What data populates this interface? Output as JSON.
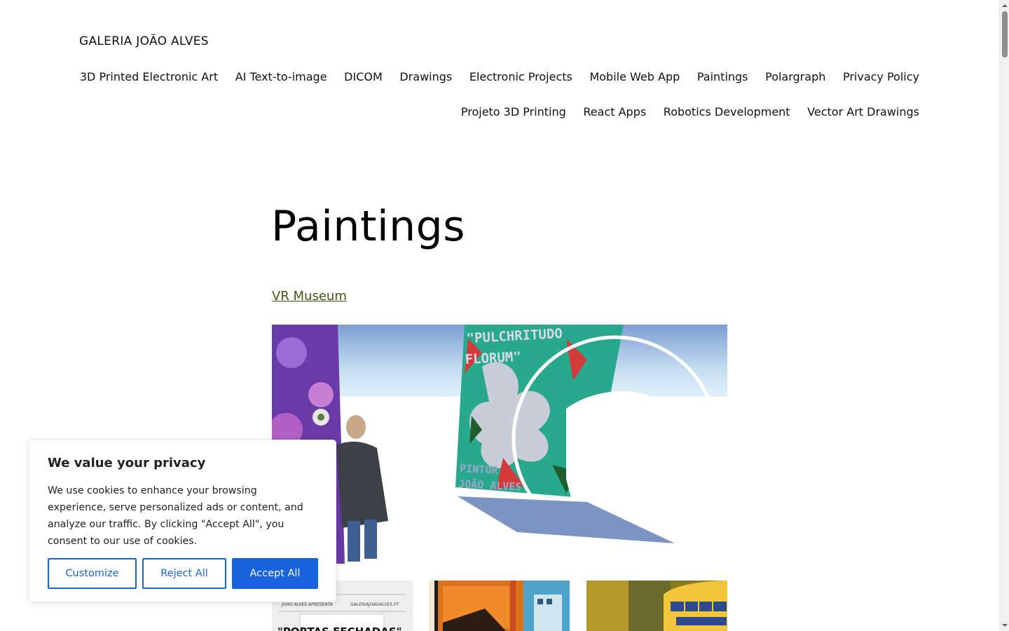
{
  "site": {
    "title": "GALERIA JOÃO ALVES"
  },
  "nav": {
    "row1": [
      "3D Printed Electronic Art",
      "AI Text-to-image",
      "DICOM",
      "Drawings",
      "Electronic Projects",
      "Mobile Web App",
      "Paintings",
      "Polargraph",
      "Privacy Policy"
    ],
    "row2": [
      "Projeto 3D Printing",
      "React Apps",
      "Robotics Development",
      "Vector Art Drawings"
    ]
  },
  "main": {
    "title": "Paintings",
    "link": "VR Museum",
    "hero": {
      "poster_line1": "\"PULCHRITUDO",
      "poster_line2": "FLORUM\"",
      "poster_line3": "PINTOR",
      "poster_line4": "JOÃO ALVES"
    },
    "thumbs": {
      "t1_left": "JOÃO ALVES APRESENTA",
      "t1_right": "GALERIAJOAOALVES.PT",
      "t1_title": "\"PORTAS FECHADAS\""
    }
  },
  "cookie": {
    "title": "We value your privacy",
    "text": "We use cookies to enhance your browsing experience, serve personalized ads or content, and analyze our traffic. By clicking \"Accept All\", you consent to our use of cookies.",
    "customize": "Customize",
    "reject": "Reject All",
    "accept": "Accept All"
  },
  "colors": {
    "accent": "#1863dc",
    "link": "#3a5a12"
  }
}
